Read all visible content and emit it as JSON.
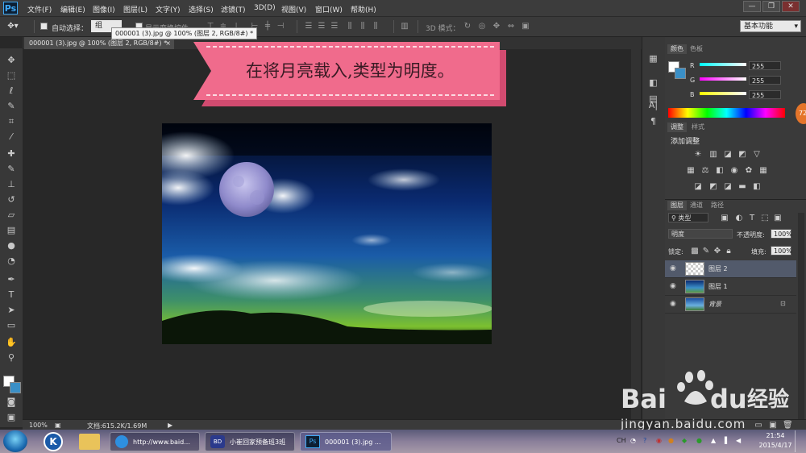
{
  "app": {
    "logo": "Ps"
  },
  "menu": [
    "文件(F)",
    "编辑(E)",
    "图像(I)",
    "图层(L)",
    "文字(Y)",
    "选择(S)",
    "滤镜(T)",
    "3D(D)",
    "视图(V)",
    "窗口(W)",
    "帮助(H)"
  ],
  "window_controls": {
    "minimize": "—",
    "restore": "❐",
    "close": "✕"
  },
  "options": {
    "auto_select_label": "自动选择：",
    "auto_select_value": "组",
    "show_transform_label": "显示变换控件",
    "mode_3d_label": "3D 模式：",
    "workspace": "基本功能"
  },
  "document": {
    "tab_label": "000001 (3).jpg @ 100% (图层 2, RGB/8#) *",
    "tooltip": "000001 (3).jpg @ 100% (图层 2, RGB/8#) *",
    "zoom": "100%",
    "doc_size": "文档:615.2K/1.69M"
  },
  "banner": {
    "text": "在将月亮载入,类型为明度。"
  },
  "color_panel": {
    "tabs": [
      "颜色",
      "色板"
    ],
    "channels": [
      {
        "label": "R",
        "value": "255"
      },
      {
        "label": "G",
        "value": "255"
      },
      {
        "label": "B",
        "value": "255"
      }
    ],
    "badge": "72"
  },
  "adjust_panel": {
    "tabs": [
      "调整",
      "样式"
    ],
    "title": "添加调整"
  },
  "layers_panel": {
    "tabs": [
      "图层",
      "通道",
      "路径"
    ],
    "kind_filter": "类型",
    "blend_mode": "明度",
    "opacity_label": "不透明度:",
    "opacity_value": "100%",
    "lock_label": "锁定:",
    "fill_label": "填充:",
    "fill_value": "100%",
    "layers": [
      {
        "name": "图层 2",
        "selected": true
      },
      {
        "name": "图层 1",
        "selected": false
      },
      {
        "name": "背景",
        "selected": false,
        "locked": true
      }
    ]
  },
  "taskbar": {
    "items": [
      "http://www.baid...",
      "小崔回家预备班3班",
      "000001 (3).jpg ..."
    ],
    "tray_lang": "CH",
    "time": "21:54",
    "date": "2015/4/17"
  },
  "watermark": {
    "brand": "Bai du 经验",
    "url": "jingyan.baidu.com"
  }
}
